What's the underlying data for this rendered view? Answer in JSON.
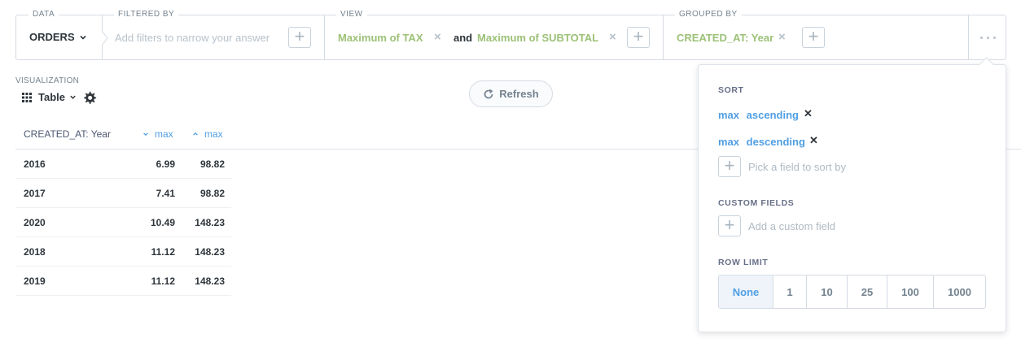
{
  "query_builder": {
    "data": {
      "label": "DATA",
      "table": "ORDERS"
    },
    "filter": {
      "label": "FILTERED BY",
      "placeholder": "Add filters to narrow your answer"
    },
    "view": {
      "label": "VIEW",
      "agg1": "Maximum of TAX",
      "and": "and",
      "agg2": "Maximum of SUBTOTAL"
    },
    "group": {
      "label": "GROUPED BY",
      "field": "CREATED_AT: Year"
    },
    "more_icon": "more-dots-icon"
  },
  "visualization": {
    "label": "VISUALIZATION",
    "type": "Table"
  },
  "refresh_label": "Refresh",
  "table": {
    "columns": [
      "CREATED_AT: Year",
      "max",
      "max"
    ],
    "rows": [
      [
        "2016",
        "6.99",
        "98.82"
      ],
      [
        "2017",
        "7.41",
        "98.82"
      ],
      [
        "2020",
        "10.49",
        "148.23"
      ],
      [
        "2018",
        "11.12",
        "148.23"
      ],
      [
        "2019",
        "11.12",
        "148.23"
      ]
    ]
  },
  "popover": {
    "sort_heading": "SORT",
    "sorts": [
      {
        "field": "max",
        "dir": "ascending"
      },
      {
        "field": "max",
        "dir": "descending"
      }
    ],
    "sort_placeholder": "Pick a field to sort by",
    "custom_heading": "CUSTOM FIELDS",
    "custom_placeholder": "Add a custom field",
    "limit_heading": "ROW LIMIT",
    "limits": [
      "None",
      "1",
      "10",
      "25",
      "100",
      "1000"
    ],
    "selected_limit": "None"
  },
  "colors": {
    "accent": "#509ee3",
    "aggregation": "#9cc177",
    "border": "#d5dbe3"
  }
}
